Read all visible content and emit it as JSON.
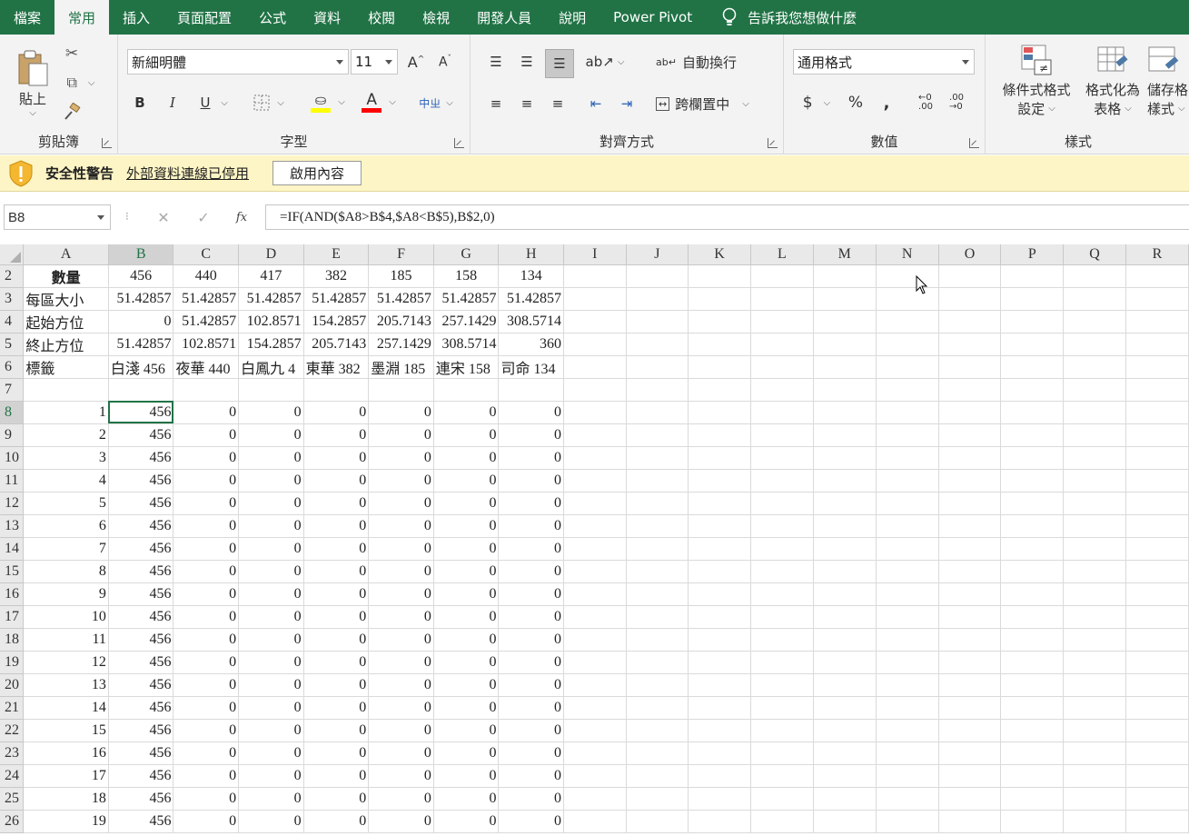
{
  "tabs": [
    {
      "label": "檔案",
      "active": false
    },
    {
      "label": "常用",
      "active": true
    },
    {
      "label": "插入",
      "active": false
    },
    {
      "label": "頁面配置",
      "active": false
    },
    {
      "label": "公式",
      "active": false
    },
    {
      "label": "資料",
      "active": false
    },
    {
      "label": "校閱",
      "active": false
    },
    {
      "label": "檢視",
      "active": false
    },
    {
      "label": "開發人員",
      "active": false
    },
    {
      "label": "說明",
      "active": false
    },
    {
      "label": "Power Pivot",
      "active": false
    }
  ],
  "tell_me": "告訴我您想做什麼",
  "ribbon": {
    "clipboard": {
      "label": "剪貼簿",
      "paste": "貼上"
    },
    "font": {
      "label": "字型",
      "font_name": "新細明體",
      "font_size": "11",
      "bold": "B",
      "italic": "I",
      "underline": "U",
      "font_color_glyph": "A"
    },
    "alignment": {
      "label": "對齊方式",
      "wrap_text": "自動換行",
      "merge_center": "跨欄置中"
    },
    "number": {
      "label": "數值",
      "format": "通用格式",
      "currency": "$",
      "percent": "%",
      "comma": ","
    },
    "styles": {
      "label": "樣式",
      "conditional_l1": "條件式格式",
      "conditional_l2": "設定",
      "table_l1": "格式化為",
      "table_l2": "表格",
      "cell_l1": "儲存格",
      "cell_l2": "樣式"
    }
  },
  "security_bar": {
    "title": "安全性警告",
    "message": "外部資料連線已停用",
    "button": "啟用內容"
  },
  "formula_bar": {
    "name_box": "B8",
    "formula": "=IF(AND($A8>B$4,$A8<B$5),B$2,0)",
    "fx": "fx"
  },
  "columns": [
    "A",
    "B",
    "C",
    "D",
    "E",
    "F",
    "G",
    "H",
    "I",
    "J",
    "K",
    "L",
    "M",
    "N",
    "O",
    "P",
    "Q",
    "R"
  ],
  "rows": [
    {
      "n": "2",
      "cells": [
        "數量",
        "456",
        "440",
        "417",
        "382",
        "185",
        "158",
        "134"
      ]
    },
    {
      "n": "3",
      "cells": [
        "每區大小",
        "51.42857",
        "51.42857",
        "51.42857",
        "51.42857",
        "51.42857",
        "51.42857",
        "51.42857"
      ]
    },
    {
      "n": "4",
      "cells": [
        "起始方位",
        "0",
        "51.42857",
        "102.8571",
        "154.2857",
        "205.7143",
        "257.1429",
        "308.5714"
      ]
    },
    {
      "n": "5",
      "cells": [
        "終止方位",
        "51.42857",
        "102.8571",
        "154.2857",
        "205.7143",
        "257.1429",
        "308.5714",
        "360"
      ]
    },
    {
      "n": "6",
      "cells": [
        "標籤",
        "白淺 456",
        "夜華 440",
        "白鳳九 4",
        "東華 382",
        "墨淵 185",
        "連宋 158",
        "司命 134"
      ]
    },
    {
      "n": "7",
      "cells": [
        "",
        "",
        "",
        "",
        "",
        "",
        "",
        ""
      ]
    },
    {
      "n": "8",
      "cells": [
        "1",
        "456",
        "0",
        "0",
        "0",
        "0",
        "0",
        "0"
      ]
    },
    {
      "n": "9",
      "cells": [
        "2",
        "456",
        "0",
        "0",
        "0",
        "0",
        "0",
        "0"
      ]
    },
    {
      "n": "10",
      "cells": [
        "3",
        "456",
        "0",
        "0",
        "0",
        "0",
        "0",
        "0"
      ]
    },
    {
      "n": "11",
      "cells": [
        "4",
        "456",
        "0",
        "0",
        "0",
        "0",
        "0",
        "0"
      ]
    },
    {
      "n": "12",
      "cells": [
        "5",
        "456",
        "0",
        "0",
        "0",
        "0",
        "0",
        "0"
      ]
    },
    {
      "n": "13",
      "cells": [
        "6",
        "456",
        "0",
        "0",
        "0",
        "0",
        "0",
        "0"
      ]
    },
    {
      "n": "14",
      "cells": [
        "7",
        "456",
        "0",
        "0",
        "0",
        "0",
        "0",
        "0"
      ]
    },
    {
      "n": "15",
      "cells": [
        "8",
        "456",
        "0",
        "0",
        "0",
        "0",
        "0",
        "0"
      ]
    },
    {
      "n": "16",
      "cells": [
        "9",
        "456",
        "0",
        "0",
        "0",
        "0",
        "0",
        "0"
      ]
    },
    {
      "n": "17",
      "cells": [
        "10",
        "456",
        "0",
        "0",
        "0",
        "0",
        "0",
        "0"
      ]
    },
    {
      "n": "18",
      "cells": [
        "11",
        "456",
        "0",
        "0",
        "0",
        "0",
        "0",
        "0"
      ]
    },
    {
      "n": "19",
      "cells": [
        "12",
        "456",
        "0",
        "0",
        "0",
        "0",
        "0",
        "0"
      ]
    },
    {
      "n": "20",
      "cells": [
        "13",
        "456",
        "0",
        "0",
        "0",
        "0",
        "0",
        "0"
      ]
    },
    {
      "n": "21",
      "cells": [
        "14",
        "456",
        "0",
        "0",
        "0",
        "0",
        "0",
        "0"
      ]
    },
    {
      "n": "22",
      "cells": [
        "15",
        "456",
        "0",
        "0",
        "0",
        "0",
        "0",
        "0"
      ]
    },
    {
      "n": "23",
      "cells": [
        "16",
        "456",
        "0",
        "0",
        "0",
        "0",
        "0",
        "0"
      ]
    },
    {
      "n": "24",
      "cells": [
        "17",
        "456",
        "0",
        "0",
        "0",
        "0",
        "0",
        "0"
      ]
    },
    {
      "n": "25",
      "cells": [
        "18",
        "456",
        "0",
        "0",
        "0",
        "0",
        "0",
        "0"
      ]
    },
    {
      "n": "26",
      "cells": [
        "19",
        "456",
        "0",
        "0",
        "0",
        "0",
        "0",
        "0"
      ]
    }
  ],
  "colors": {
    "accent": "#217346",
    "security_bg": "#fdf5c5",
    "highlight_yellow": "#ffff00",
    "font_red": "#ff0000"
  }
}
